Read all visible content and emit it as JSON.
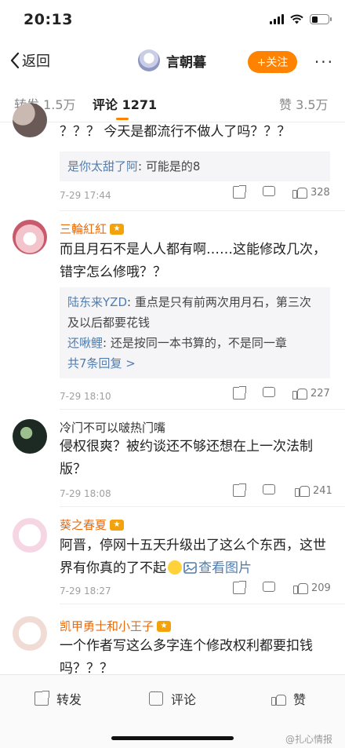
{
  "status_bar": {
    "time": "20:13"
  },
  "nav": {
    "back_label": "返回",
    "username": "言朝暮",
    "follow_label": "+关注",
    "more_label": "···"
  },
  "tabs": [
    {
      "label": "转发 1.5万"
    },
    {
      "label": "评论 1271"
    },
    {
      "label": "赞 3.5万"
    }
  ],
  "comments": [
    {
      "name": "",
      "text": "？？？ 今天是都流行不做人了吗？？？",
      "replies": [
        {
          "name": "是你太甜了阿",
          "text": ": 可能是的8"
        }
      ],
      "reply_more": "",
      "time": "7-29 17:44",
      "likes": "328"
    },
    {
      "name": "三輪紅紅",
      "text": "而且月石不是人人都有啊……这能修改几次，错字怎么修哦？？",
      "replies": [
        {
          "name": "陆东来YZD",
          "text": ": 重点是只有前两次用月石，第三次及以后都要花钱"
        },
        {
          "name": "还啾鲤",
          "text": ": 还是按同一本书算的，不是同一章"
        }
      ],
      "reply_more": "共7条回复 >",
      "time": "7-29 18:10",
      "likes": "227"
    },
    {
      "name": "冷门不可以啵热门嘴",
      "text": "侵权很爽？被约谈还不够还想在上一次法制版？",
      "time": "7-29 18:08",
      "likes": "241"
    },
    {
      "name": "葵之春夏",
      "text_a": "阿晋，停网十五天升级出了这么个东西，这世界有你真的了不起",
      "text_link": "查看图片",
      "time": "7-29 18:27",
      "likes": "209"
    },
    {
      "name": "凯甲勇士和小王子",
      "text": "一个作者写这么多字连个修改权利都要扣钱吗？？？"
    }
  ],
  "bottom_bar": {
    "repost_label": "转发",
    "comment_label": "评论",
    "like_label": "赞"
  },
  "watermark": "@扎心情报"
}
